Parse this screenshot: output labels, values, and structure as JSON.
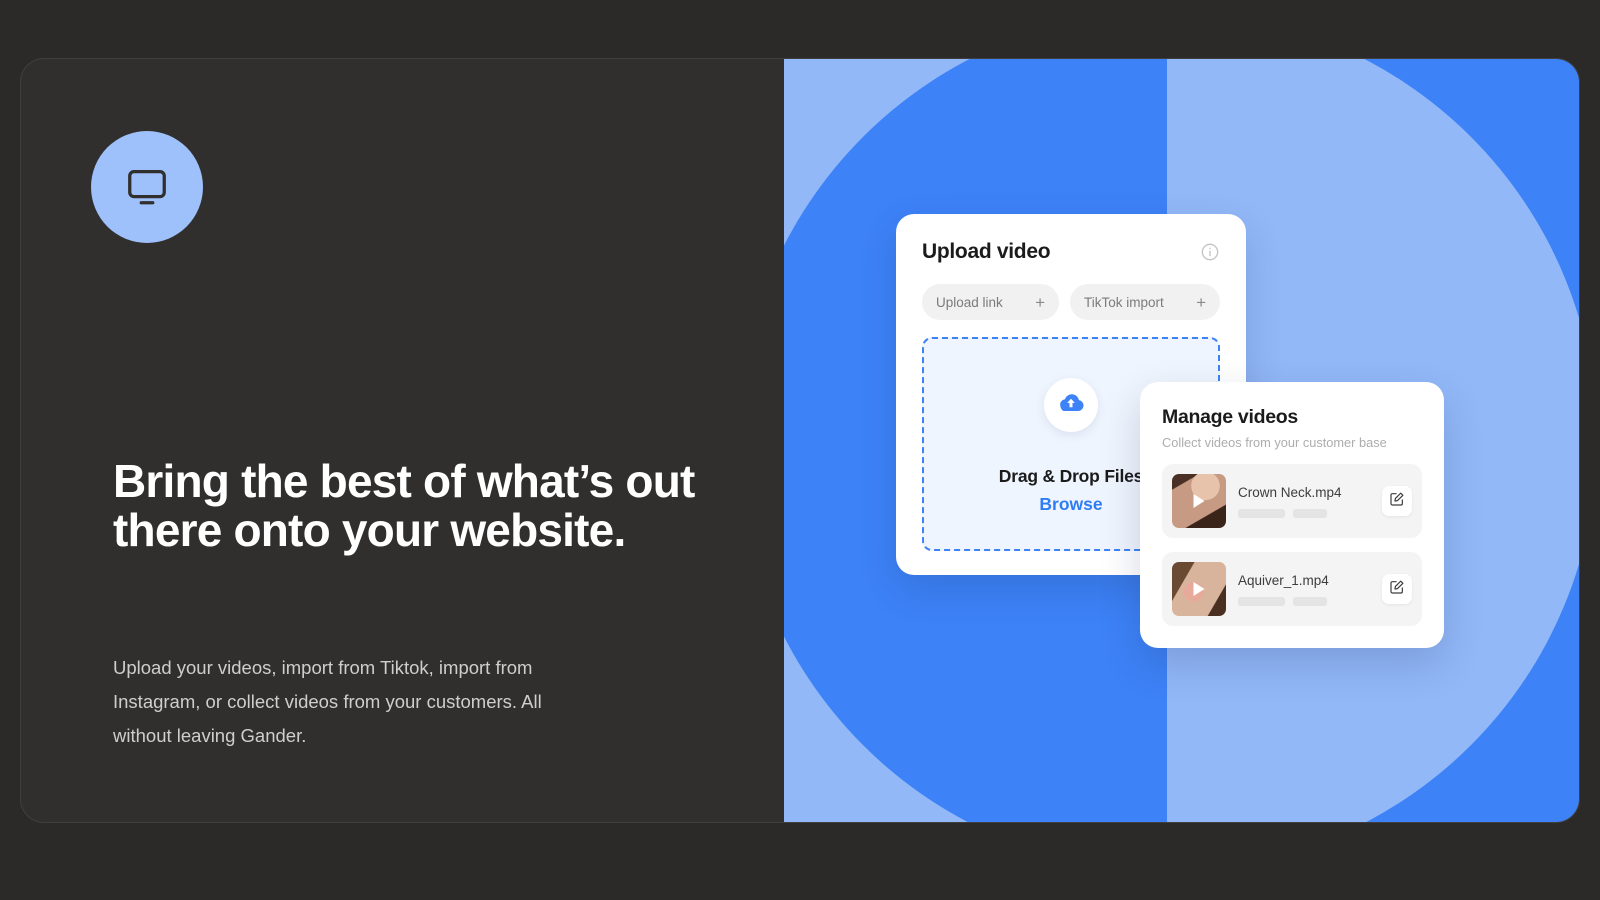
{
  "theme": {
    "page_bg": "#2b2a28",
    "panel_bg": "#302f2d",
    "blue_light": "#92b8f8",
    "blue_dark": "#3d82f7",
    "accent_link": "#2f7df4",
    "logo_circle": "#9ec0fb"
  },
  "hero": {
    "logo_icon": "monitor-icon",
    "headline": "Bring the best of what’s out there onto your website.",
    "body": "Upload your videos, import from Tiktok, import from Instagram, or collect videos from your customers. All without leaving Gander."
  },
  "upload_card": {
    "title": "Upload video",
    "info_icon": "info-circle-icon",
    "pills": [
      {
        "label": "Upload link",
        "action_icon": "plus-icon",
        "action_glyph": "+"
      },
      {
        "label": "TikTok import",
        "action_icon": "plus-icon",
        "action_glyph": "+"
      }
    ],
    "dropzone": {
      "upload_icon": "cloud-upload-icon",
      "primary_text": "Drag & Drop Files",
      "browse_label": "Browse"
    }
  },
  "manage_card": {
    "title": "Manage videos",
    "subtitle": "Collect videos from your customer base",
    "rows": [
      {
        "filename": "Crown Neck.mp4",
        "play_icon": "play-icon",
        "edit_icon": "edit-pencil-icon"
      },
      {
        "filename": "Aquiver_1.mp4",
        "play_icon": "play-icon",
        "edit_icon": "edit-pencil-icon"
      }
    ]
  }
}
